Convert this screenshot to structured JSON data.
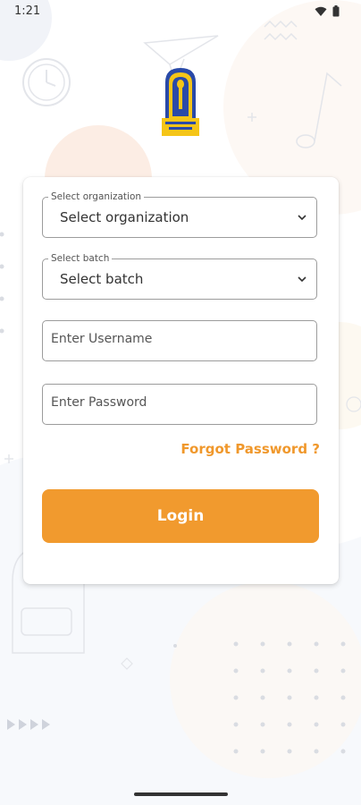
{
  "status_bar": {
    "time": "1:21",
    "icons": [
      "wifi-icon",
      "battery-icon"
    ]
  },
  "logo": {
    "name": "institution-logo"
  },
  "form": {
    "organization": {
      "label": "Select organization",
      "value": "Select organization"
    },
    "batch": {
      "label": "Select batch",
      "value": "Select batch"
    },
    "username": {
      "placeholder": "Enter Username"
    },
    "password": {
      "placeholder": "Enter Password"
    },
    "forgot_password": "Forgot Password ?",
    "login_label": "Login"
  },
  "colors": {
    "accent": "#f19a2e",
    "border": "#9c9c9c"
  }
}
